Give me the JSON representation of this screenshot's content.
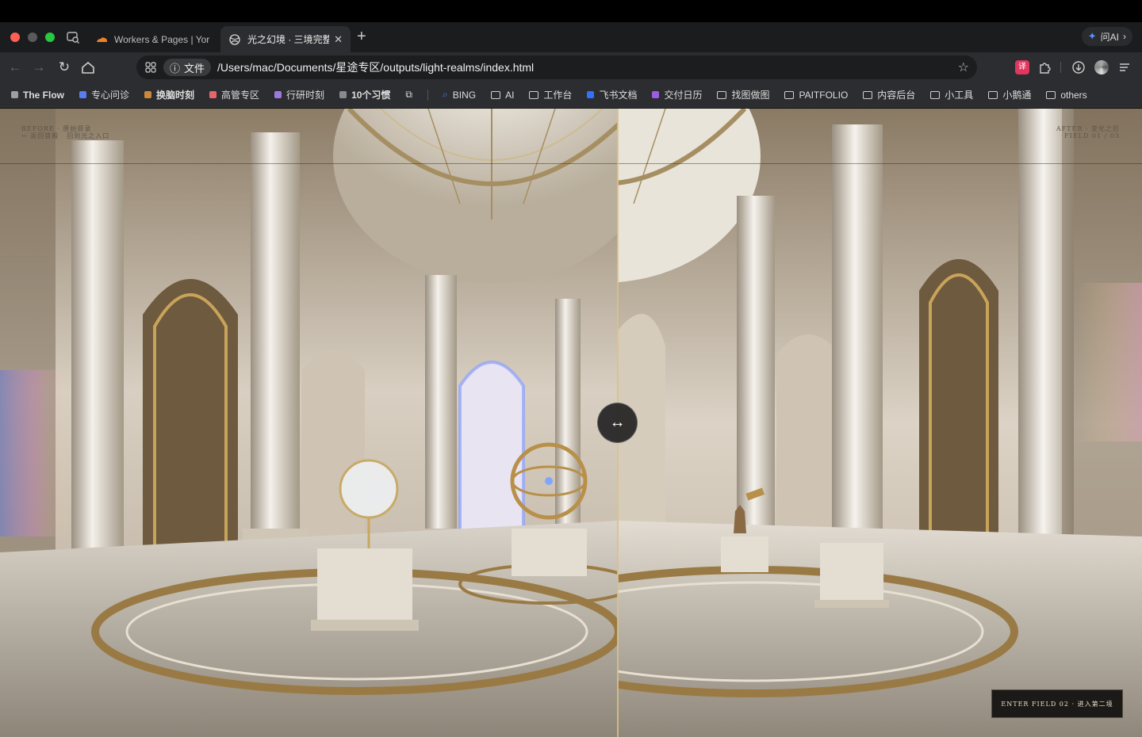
{
  "browser": {
    "tabs": [
      {
        "title": "Workers & Pages | York",
        "active": false
      },
      {
        "title": "光之幻境 · 三境完整",
        "active": true
      }
    ],
    "new_tab": "+",
    "ai_button": "问AI",
    "address": {
      "site_chip": "文件",
      "url": "/Users/mac/Documents/星途专区/outputs/light-realms/index.html"
    },
    "translate_icon": "译",
    "bookmarks": [
      {
        "label": "The Flow",
        "kind": "dot",
        "color": "#9e9e9e",
        "bold": true
      },
      {
        "label": "专心问诊",
        "kind": "dot",
        "color": "#5b7cf0",
        "bold": false
      },
      {
        "label": "换脑时刻",
        "kind": "dot",
        "color": "#c9883a",
        "bold": true
      },
      {
        "label": "高管专区",
        "kind": "dot",
        "color": "#e8646a",
        "bold": false
      },
      {
        "label": "行研时刻",
        "kind": "dot",
        "color": "#9b7ae0",
        "bold": false
      },
      {
        "label": "10个习惯",
        "kind": "dot",
        "color": "#8a8a8a",
        "bold": true
      },
      {
        "label": "BING",
        "kind": "search",
        "color": "#3b82f6",
        "bold": false
      },
      {
        "label": "AI",
        "kind": "folder",
        "bold": false
      },
      {
        "label": "工作台",
        "kind": "folder",
        "bold": false
      },
      {
        "label": "飞书文档",
        "kind": "app",
        "color": "#3370ff",
        "bold": false
      },
      {
        "label": "交付日历",
        "kind": "app",
        "color": "#9c5de0",
        "bold": false
      },
      {
        "label": "找图做图",
        "kind": "folder",
        "bold": false
      },
      {
        "label": "PAITFOLIO",
        "kind": "folder",
        "bold": false
      },
      {
        "label": "内容后台",
        "kind": "folder",
        "bold": false
      },
      {
        "label": "小工具",
        "kind": "folder",
        "bold": false
      },
      {
        "label": "小鹅通",
        "kind": "folder",
        "bold": false
      },
      {
        "label": "others",
        "kind": "folder",
        "bold": false
      }
    ]
  },
  "page": {
    "before_label": "BEFORE · 原始目录",
    "back_link": "←  返回首殿",
    "return_link": "回到光之入口",
    "after_label": "AFTER · 变化之后",
    "field_counter": "FIELD 01 / 03",
    "handle_icon": "↔",
    "enter_button": "ENTER FIELD 02  ·  进入第二境"
  }
}
